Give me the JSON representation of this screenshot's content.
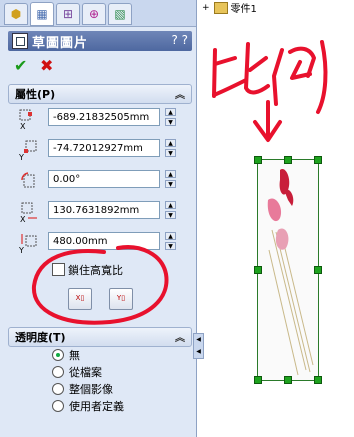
{
  "tabs": [
    {
      "icon": "feature-manager-icon"
    },
    {
      "icon": "property-manager-icon"
    },
    {
      "icon": "configuration-manager-icon"
    },
    {
      "icon": "dimxpert-icon"
    },
    {
      "icon": "display-manager-icon"
    }
  ],
  "property_manager": {
    "title": "草圖圖片",
    "help": "? ?"
  },
  "actions": {
    "ok_icon": "check-icon",
    "cancel_icon": "cross-icon"
  },
  "properties": {
    "heading": "屬性(P)",
    "x_position": "-689.21832505mm",
    "y_position": "-74.72012927mm",
    "angle": "0.00°",
    "width": "130.7631892mm",
    "height": "480.00mm",
    "lock_aspect_label": "鎖住高寬比"
  },
  "transparency": {
    "heading": "透明度(T)",
    "options": [
      "無",
      "從檔案",
      "整個影像",
      "使用者定義"
    ],
    "selected": 0
  },
  "tree": {
    "part_label": "零件1"
  },
  "annotation": {
    "text": "比例"
  },
  "colors": {
    "accent": "#4e68a0",
    "ink": "#e8112d",
    "handle": "#1ea21e"
  }
}
